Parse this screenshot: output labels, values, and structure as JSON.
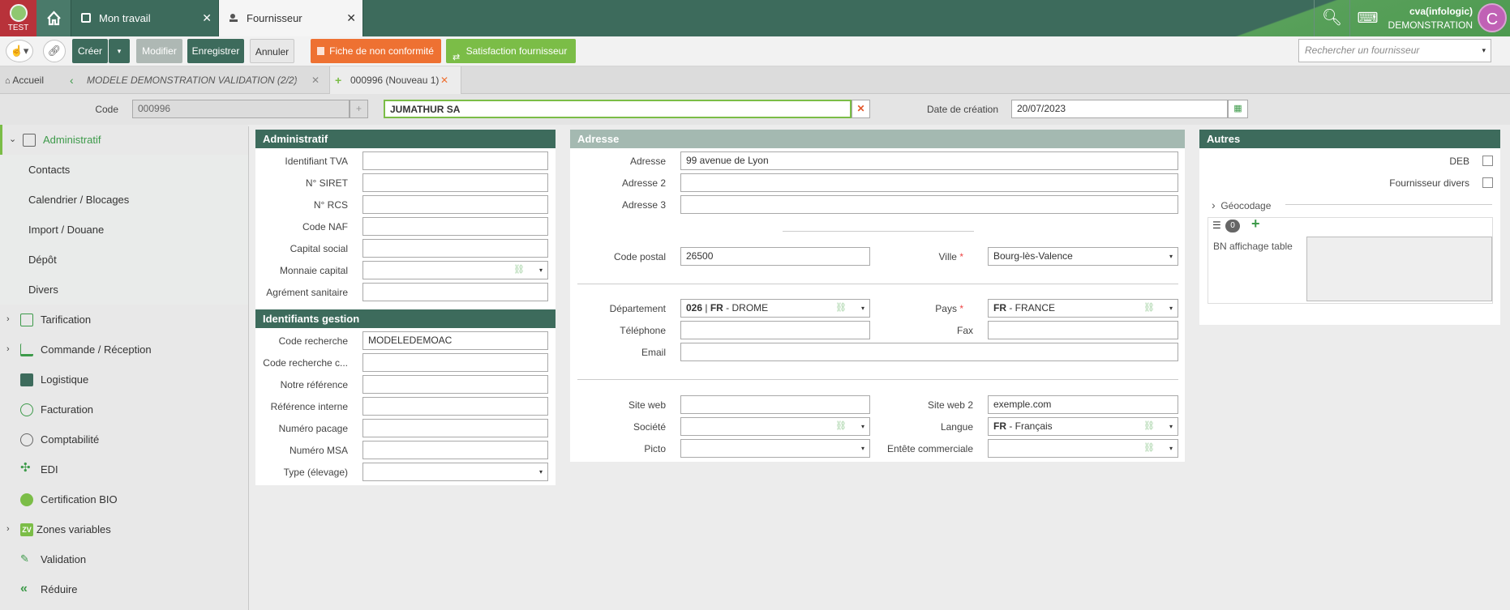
{
  "app": {
    "env_label": "TEST",
    "user_name": "cva(infologic)",
    "user_company": "DEMONSTRATION",
    "avatar_letter": "C",
    "brand_color": "#3d6b5c"
  },
  "window_tabs": [
    {
      "label": "Mon travail",
      "close": "✕"
    },
    {
      "label": "Fournisseur",
      "close": "✕"
    }
  ],
  "toolbar": {
    "create": "Créer",
    "modify": "Modifier",
    "save": "Enregistrer",
    "cancel": "Annuler",
    "nonconformity": "Fiche de non conformité",
    "satisfaction": "Satisfaction fournisseur",
    "search_placeholder": "Rechercher un fournisseur"
  },
  "breadcrumb": {
    "home": "Accueil",
    "model": "MODELE DEMONSTRATION VALIDATION (2/2)",
    "current": "000996 (Nouveau 1)"
  },
  "header": {
    "code_label": "Code",
    "code_value": "000996",
    "name_value": "JUMATHUR SA",
    "date_label": "Date de création",
    "date_value": "20/07/2023"
  },
  "sidebar": {
    "section": "Administratif",
    "subitems": [
      "Contacts",
      "Calendrier / Blocages",
      "Import / Douane",
      "Dépôt",
      "Divers"
    ],
    "items": [
      "Tarification",
      "Commande / Réception",
      "Logistique",
      "Facturation",
      "Comptabilité",
      "EDI",
      "Certification BIO",
      "Zones variables",
      "Validation",
      "Réduire"
    ]
  },
  "administratif": {
    "title": "Administratif",
    "fields": [
      {
        "label": "Identifiant TVA",
        "value": ""
      },
      {
        "label": "N° SIRET",
        "value": ""
      },
      {
        "label": "N° RCS",
        "value": ""
      },
      {
        "label": "Code NAF",
        "value": ""
      },
      {
        "label": "Capital social",
        "value": ""
      },
      {
        "label": "Monnaie capital",
        "value": ""
      },
      {
        "label": "Agrément sanitaire",
        "value": ""
      }
    ]
  },
  "identifiants": {
    "title": "Identifiants gestion",
    "fields": [
      {
        "label": "Code recherche",
        "value": "MODELEDEMOAC"
      },
      {
        "label": "Code recherche c...",
        "value": ""
      },
      {
        "label": "Notre référence",
        "value": ""
      },
      {
        "label": "Référence interne",
        "value": ""
      },
      {
        "label": "Numéro pacage",
        "value": ""
      },
      {
        "label": "Numéro MSA",
        "value": ""
      },
      {
        "label": "Type (élevage)",
        "value": ""
      }
    ]
  },
  "adresse": {
    "title": "Adresse",
    "adresse_label": "Adresse",
    "adresse": "99 avenue de Lyon",
    "adresse2_label": "Adresse 2",
    "adresse2": "",
    "adresse3_label": "Adresse 3",
    "adresse3": "",
    "cp_label": "Code postal",
    "cp": "26500",
    "ville_label": "Ville",
    "ville": "Bourg-lès-Valence",
    "dept_label": "Département",
    "dept_code": "026",
    "dept_country": "FR",
    "dept_name": "DROME",
    "pays_label": "Pays",
    "pays_code": "FR",
    "pays_name": "FRANCE",
    "tel_label": "Téléphone",
    "tel": "",
    "fax_label": "Fax",
    "fax": "",
    "email_label": "Email",
    "email": "",
    "web_label": "Site web",
    "web": "",
    "web2_label": "Site web 2",
    "web2": "exemple.com",
    "societe_label": "Société",
    "societe": "",
    "langue_label": "Langue",
    "langue_code": "FR",
    "langue_name": "Français",
    "picto_label": "Picto",
    "picto": "",
    "entete_label": "Entête commerciale",
    "entete": "",
    "sep": " | ",
    "dash": " - ",
    "asterisk": "*"
  },
  "autres": {
    "title": "Autres",
    "deb": "DEB",
    "divers": "Fournisseur divers",
    "geo": "Géocodage",
    "count": "0",
    "bn": "BN affichage table"
  }
}
